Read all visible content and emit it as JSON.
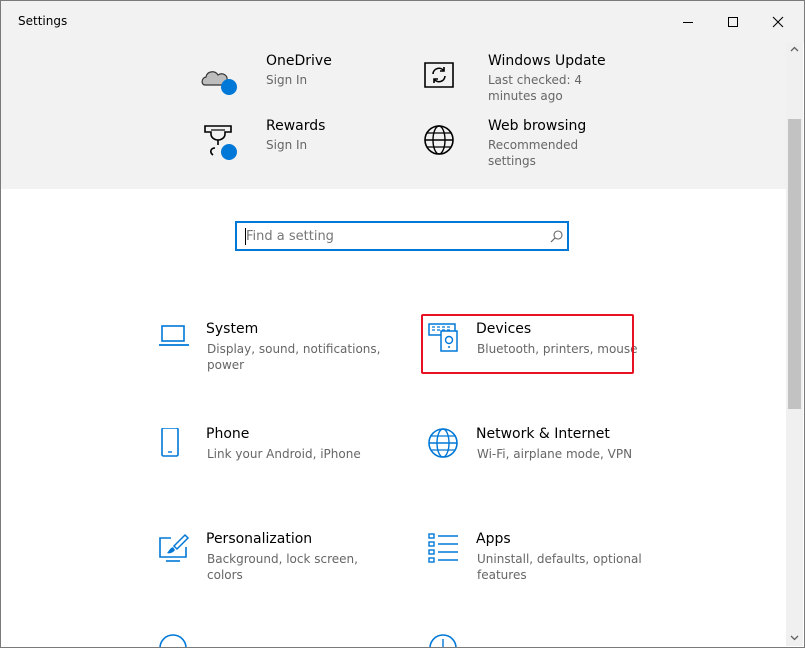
{
  "window": {
    "title": "Settings",
    "controls": [
      "minimize",
      "maximize",
      "close"
    ]
  },
  "header": {
    "tips": [
      {
        "title": "OneDrive",
        "subtitle": "Sign In",
        "icon": "onedrive-cloud-icon"
      },
      {
        "title": "Windows Update",
        "subtitle": "Last checked: 4 minutes ago",
        "icon": "windows-update-icon"
      },
      {
        "title": "Rewards",
        "subtitle": "Sign In",
        "icon": "rewards-trophy-icon"
      },
      {
        "title": "Web browsing",
        "subtitle": "Recommended settings",
        "icon": "globe-icon"
      }
    ]
  },
  "search": {
    "placeholder": "Find a setting",
    "value": ""
  },
  "categories": [
    {
      "title": "System",
      "description": "Display, sound, notifications, power",
      "icon": "laptop-icon"
    },
    {
      "title": "Devices",
      "description": "Bluetooth, printers, mouse",
      "icon": "devices-icon"
    },
    {
      "title": "Phone",
      "description": "Link your Android, iPhone",
      "icon": "phone-icon"
    },
    {
      "title": "Network & Internet",
      "description": "Wi-Fi, airplane mode, VPN",
      "icon": "globe-icon"
    },
    {
      "title": "Personalization",
      "description": "Background, lock screen, colors",
      "icon": "paint-icon"
    },
    {
      "title": "Apps",
      "description": "Uninstall, defaults, optional features",
      "icon": "apps-list-icon"
    }
  ],
  "colors": {
    "accent": "#0078d7",
    "highlight_box": "#e81123",
    "header_background": "#f2f2f2"
  }
}
